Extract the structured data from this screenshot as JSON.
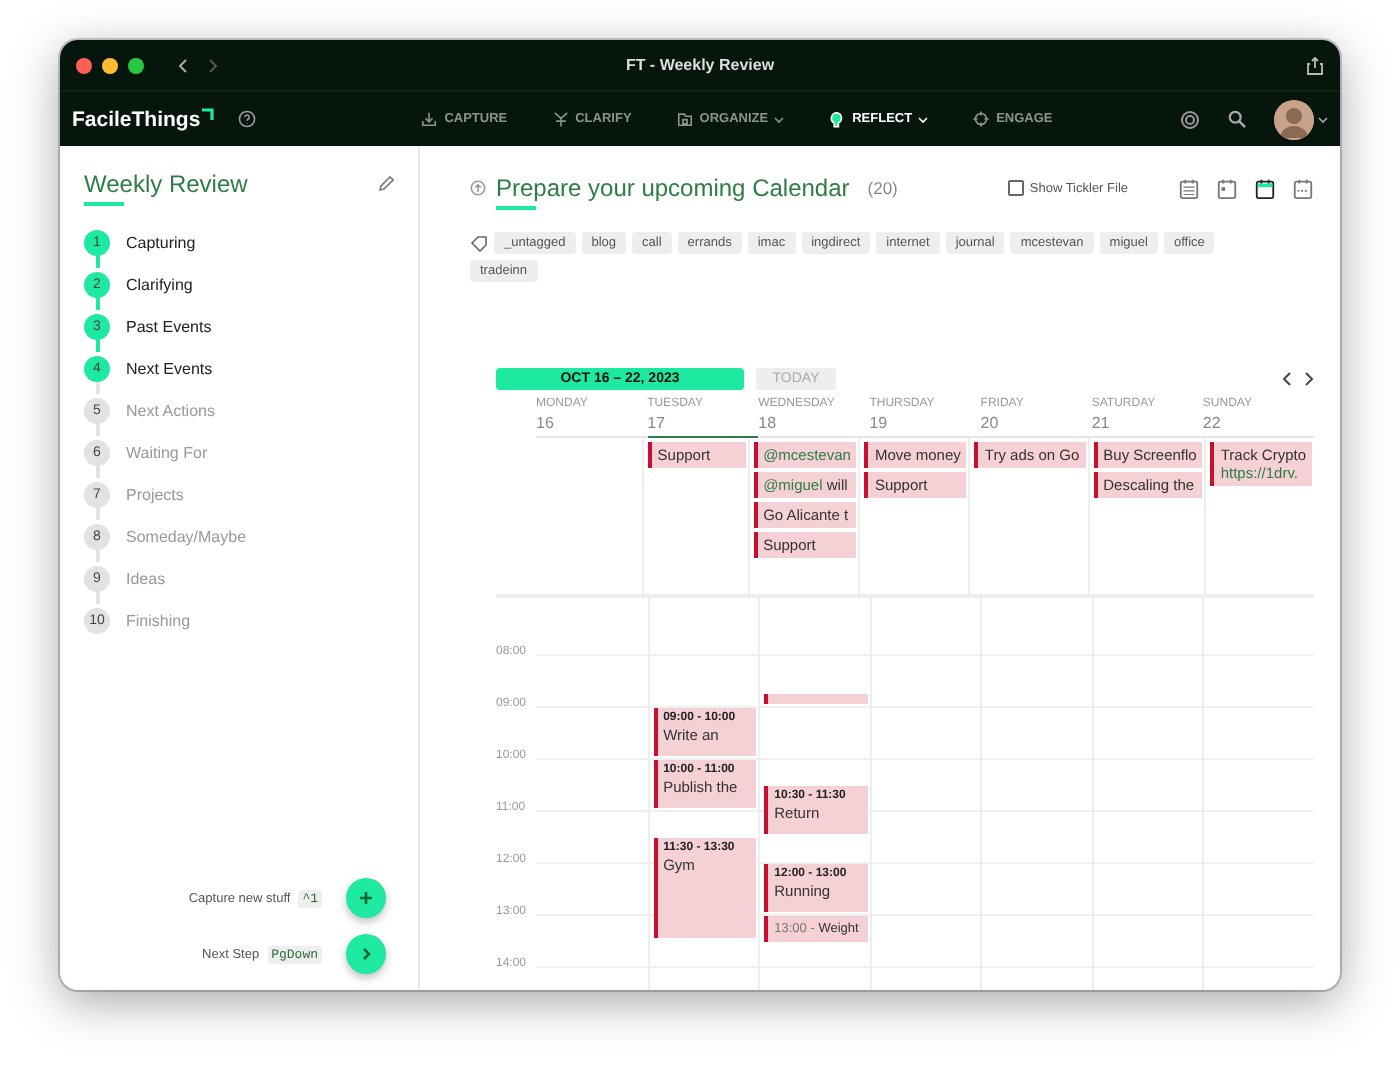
{
  "titlebar": {
    "title": "FT - Weekly Review"
  },
  "navbar": {
    "logo": "FacileThings",
    "items": [
      {
        "label": "CAPTURE",
        "dropdown": false,
        "selected": false
      },
      {
        "label": "CLARIFY",
        "dropdown": false,
        "selected": false
      },
      {
        "label": "ORGANIZE",
        "dropdown": true,
        "selected": false
      },
      {
        "label": "REFLECT",
        "dropdown": true,
        "selected": true
      },
      {
        "label": "ENGAGE",
        "dropdown": false,
        "selected": false
      }
    ]
  },
  "sidebar": {
    "title": "Weekly Review",
    "steps": [
      {
        "number": "1",
        "label": "Capturing",
        "done": true
      },
      {
        "number": "2",
        "label": "Clarifying",
        "done": true
      },
      {
        "number": "3",
        "label": "Past Events",
        "done": true
      },
      {
        "number": "4",
        "label": "Next Events",
        "done": true
      },
      {
        "number": "5",
        "label": "Next Actions",
        "done": false
      },
      {
        "number": "6",
        "label": "Waiting For",
        "done": false
      },
      {
        "number": "7",
        "label": "Projects",
        "done": false
      },
      {
        "number": "8",
        "label": "Someday/Maybe",
        "done": false
      },
      {
        "number": "9",
        "label": "Ideas",
        "done": false
      },
      {
        "number": "10",
        "label": "Finishing",
        "done": false
      }
    ],
    "actions": [
      {
        "label": "Capture new stuff",
        "shortcut": "^1"
      },
      {
        "label": "Next Step",
        "shortcut": "PgDown"
      }
    ]
  },
  "main": {
    "title": "Prepare your upcoming Calendar",
    "count": "(20)",
    "tickler": {
      "label": "Show Tickler File",
      "checked": false
    },
    "views": [
      {
        "selected": false
      },
      {
        "selected": false
      },
      {
        "selected": true
      },
      {
        "selected": false
      }
    ],
    "tags": [
      "_untagged",
      "blog",
      "call",
      "errands",
      "imac",
      "ingdirect",
      "internet",
      "journal",
      "mcestevan",
      "miguel",
      "office",
      "tradeinn"
    ],
    "range": "OCT 16 – 22, 2023",
    "today": {
      "label": "TODAY",
      "disabled": true
    }
  },
  "calendar": {
    "hours": [
      "08:00",
      "09:00",
      "10:00",
      "11:00",
      "12:00",
      "13:00",
      "14:00"
    ],
    "days": [
      {
        "name": "MONDAY",
        "date": "16",
        "selected": false
      },
      {
        "name": "TUESDAY",
        "date": "17",
        "selected": true,
        "all_day": [
          {
            "text": "Support"
          }
        ],
        "events": [
          {
            "kind": "timed",
            "time": "09:00 - 10:00",
            "title": "Write an"
          },
          {
            "kind": "timed",
            "time": "10:00 - 11:00",
            "title": "Publish the"
          },
          {
            "kind": "timed",
            "time": "11:30 - 13:30",
            "title": "Gym"
          }
        ]
      },
      {
        "name": "WEDNESDAY",
        "date": "18",
        "selected": false,
        "all_day": [
          {
            "mention": "@mcestevan"
          },
          {
            "mention": "@miguel",
            "text": "will"
          },
          {
            "text": "Go Alicante t"
          },
          {
            "text": "Support"
          }
        ],
        "events": [
          {
            "kind": "clipped"
          },
          {
            "kind": "timed",
            "time": "10:30 - 11:30",
            "title": "Return"
          },
          {
            "kind": "timed",
            "time": "12:00 - 13:00",
            "title": "Running"
          },
          {
            "kind": "inline",
            "time": "13:00 -",
            "title": "Weight"
          }
        ]
      },
      {
        "name": "THURSDAY",
        "date": "19",
        "selected": false,
        "all_day": [
          {
            "text": "Move money"
          },
          {
            "text": "Support"
          }
        ]
      },
      {
        "name": "FRIDAY",
        "date": "20",
        "selected": false,
        "all_day": [
          {
            "text": "Try ads on Go"
          }
        ]
      },
      {
        "name": "SATURDAY",
        "date": "21",
        "selected": false,
        "all_day": [
          {
            "text": "Buy Screenflo"
          },
          {
            "text": "Descaling the"
          }
        ]
      },
      {
        "name": "SUNDAY",
        "date": "22",
        "selected": false,
        "all_day": [
          {
            "text": "Track Crypto",
            "link": "https://1drv."
          }
        ]
      }
    ]
  }
}
